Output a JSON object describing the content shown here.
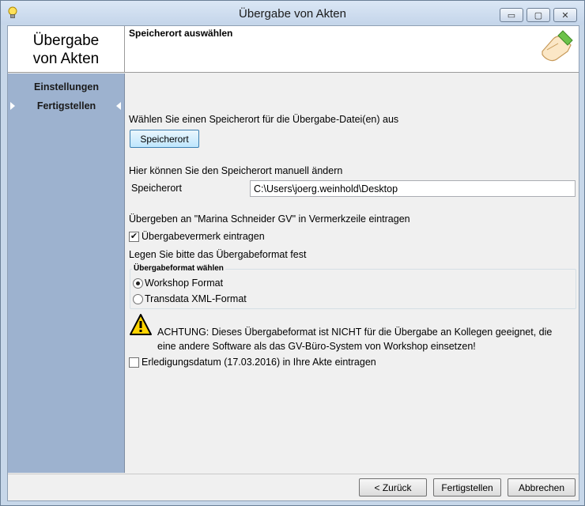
{
  "window": {
    "title": "Übergabe von Akten",
    "minimize_glyph": "▭",
    "maximize_glyph": "▢",
    "close_glyph": "✕"
  },
  "header": {
    "app_title_line1": "Übergabe",
    "app_title_line2": "von Akten",
    "step_title": "Speicherort auswählen"
  },
  "sidebar": {
    "items": [
      {
        "label": "Einstellungen",
        "active": false
      },
      {
        "label": "Fertigstellen",
        "active": true
      }
    ]
  },
  "content": {
    "choose_prompt": "Wählen Sie einen Speicherort für die Übergabe-Datei(en) aus",
    "choose_button": "Speicherort",
    "manual_prompt": "Hier können Sie den Speicherort manuell ändern",
    "path_label": "Speicherort",
    "path_value": "C:\\Users\\joerg.weinhold\\Desktop",
    "note_prompt": "Übergeben an \"Marina Schneider GV\" in Vermerkzeile eintragen",
    "note_checkbox": {
      "label": "Übergabevermerk eintragen",
      "checked": true
    },
    "format_prompt": "Legen Sie bitte das Übergabeformat fest",
    "format_group": {
      "legend": "Übergabeformat wählen",
      "options": [
        {
          "label": "Workshop Format",
          "selected": true
        },
        {
          "label": "Transdata XML-Format",
          "selected": false
        }
      ]
    },
    "warning": {
      "line1": "ACHTUNG: Dieses Übergabeformat ist NICHT für die Übergabe an Kollegen geeignet, die",
      "line2": "eine andere Software als das GV-Büro-System von Workshop einsetzen!"
    },
    "done_checkbox": {
      "label": "Erledigungsdatum (17.03.2016) in Ihre Akte eintragen",
      "checked": false
    },
    "check_glyph": "✔"
  },
  "footer": {
    "back": "< Zurück",
    "finish": "Fertigstellen",
    "cancel": "Abbrechen"
  }
}
